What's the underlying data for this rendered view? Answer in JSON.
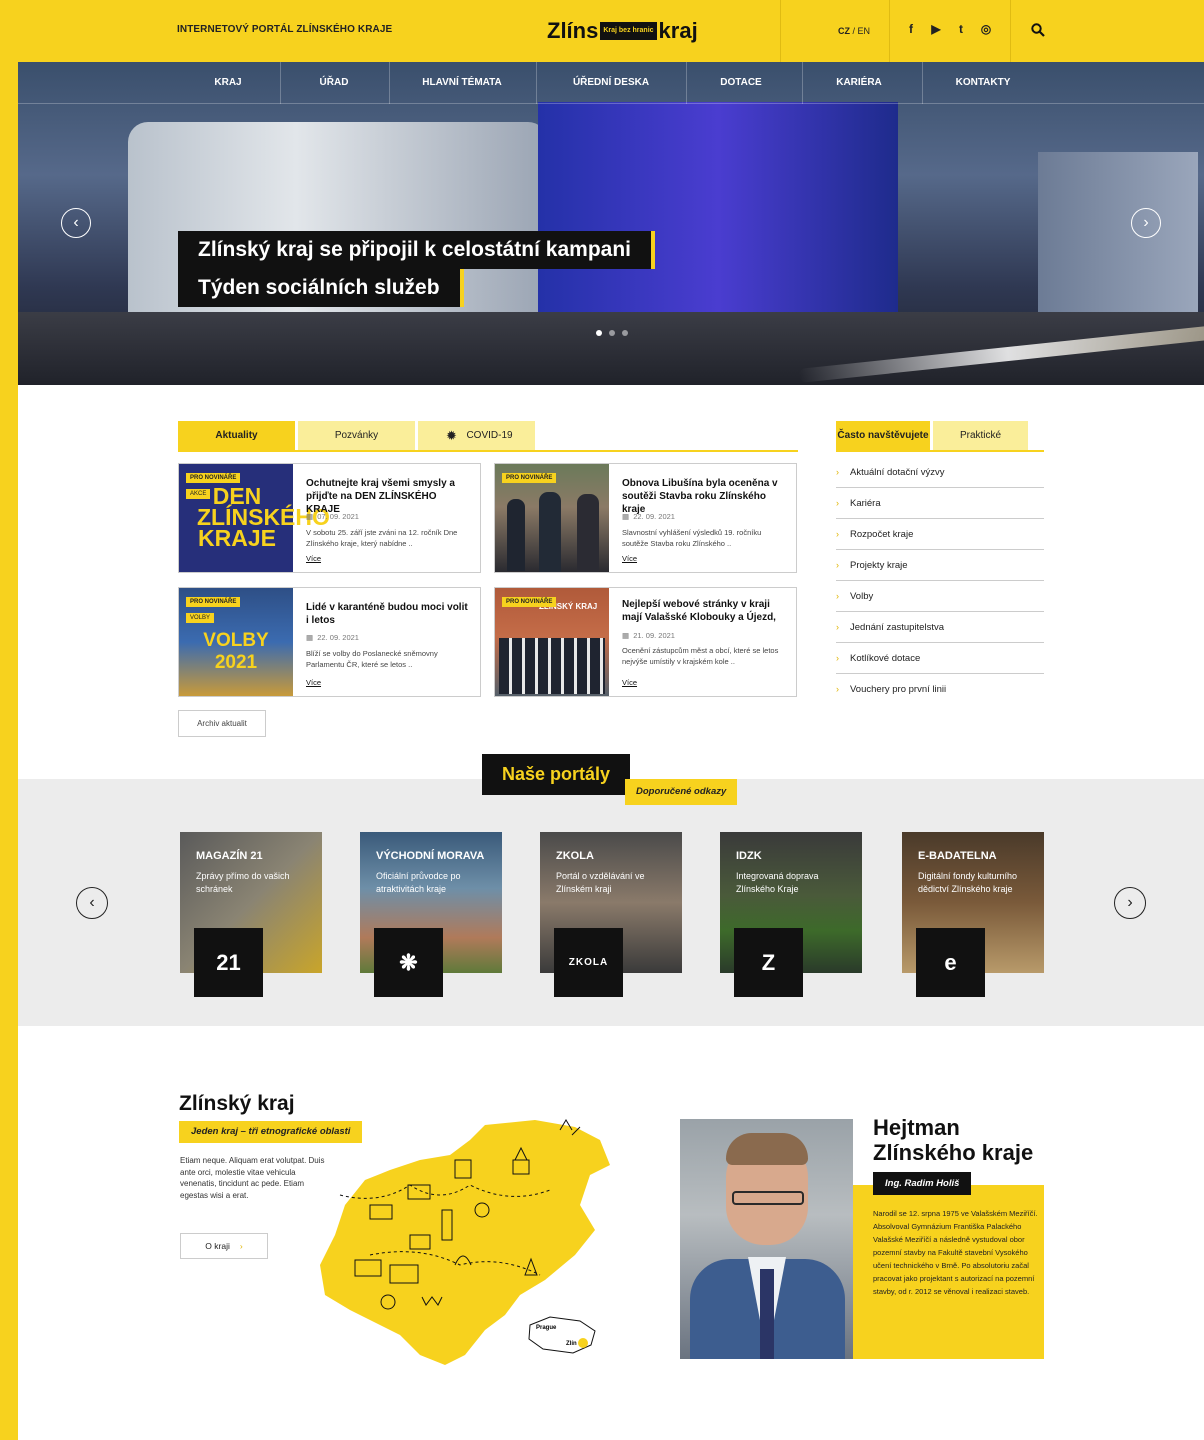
{
  "header": {
    "portal_label": "INTERNETOVÝ PORTÁL ZLÍNSKÉHO KRAJE",
    "logo_left": "Zlíns",
    "logo_box": "Kraj bez hranic",
    "logo_right": "kraj",
    "lang_cz": "CZ",
    "lang_sep": " / ",
    "lang_en": "EN",
    "socials": [
      "f",
      "▶",
      "t",
      "◎"
    ]
  },
  "nav": [
    "KRAJ",
    "ÚŘAD",
    "HLAVNÍ TÉMATA",
    "ÚŘEDNÍ DESKA",
    "DOTACE",
    "KARIÉRA",
    "KONTAKTY"
  ],
  "hero": {
    "title_line1": "Zlínský kraj se připojil k celostátní kampani",
    "title_line2": "Týden sociálních služeb",
    "prev": "‹",
    "next": "›"
  },
  "news": {
    "tabs": [
      "Aktuality",
      "Pozvánky",
      "COVID-19"
    ],
    "cards": [
      {
        "badge": "PRO NOVINÁŘE",
        "badge2": "AKCE",
        "img_text": "DEN ZLÍNSKÉHO KRAJE",
        "title": "Ochutnejte kraj všemi smysly a přijďte na DEN ZLÍNSKÉHO KRAJE",
        "date": "07. 09. 2021",
        "text": "V sobotu 25. září jste zváni na 12. ročník Dne Zlínského kraje, který nabídne ..",
        "more": "Více"
      },
      {
        "badge": "PRO NOVINÁŘE",
        "badge2": "",
        "img_text": "",
        "title": "Obnova Libušína byla oceněna v soutěži Stavba roku Zlínského kraje",
        "date": "22. 09. 2021",
        "text": "Slavnostní vyhlášení výsledků 19. ročníku soutěže Stavba roku Zlínského ..",
        "more": "Více"
      },
      {
        "badge": "PRO NOVINÁŘE",
        "badge2": "VOLBY",
        "img_text": "VOLBY 2021",
        "title": "Lidé v karanténě budou moci volit i letos",
        "date": "22. 09. 2021",
        "text": "Blíží se volby do Poslanecké sněmovny Parlamentu ČR, které se letos ..",
        "more": "Více"
      },
      {
        "badge": "PRO NOVINÁŘE",
        "badge2": "",
        "img_text": "ZLÍNSKÝ KRAJ",
        "title": "Nejlepší webové stránky v kraji mají Valašské Klobouky a Újezd,",
        "date": "21. 09. 2021",
        "text": "Ocenění zástupcům měst a obcí, které se letos nejvýše umístily v krajském kole ..",
        "more": "Více"
      }
    ],
    "archive": "Archiv aktualit"
  },
  "side": {
    "tabs": [
      "Často navštěvujete",
      "Praktické"
    ],
    "links": [
      "Aktuální dotační výzvy",
      "Kariéra",
      "Rozpočet kraje",
      "Projekty kraje",
      "Volby",
      "Jednání zastupitelstva",
      "Kotlíkové dotace",
      "Vouchery pro první linii"
    ]
  },
  "portals": {
    "title": "Naše portály",
    "subtitle": "Doporučené odkazy",
    "items": [
      {
        "name": "MAGAZÍN 21",
        "desc": "Zprávy přímo do vašich schránek",
        "icon": "21"
      },
      {
        "name": "VÝCHODNÍ MORAVA",
        "desc": "Oficiální průvodce po atraktivitách kraje",
        "icon": "❋"
      },
      {
        "name": "ZKOLA",
        "desc": "Portál o vzdělávání ve Zlínském kraji",
        "icon": "ZKOLA"
      },
      {
        "name": "IDZK",
        "desc": "Integrovaná doprava Zlínského Kraje",
        "icon": "Z"
      },
      {
        "name": "E-BADATELNA",
        "desc": "Digitální fondy kulturního dědictví Zlínského kraje",
        "icon": "e"
      }
    ]
  },
  "region": {
    "title": "Zlínský kraj",
    "subtitle": "Jeden kraj – tři etnografické oblasti",
    "text": "Etiam neque. Aliquam erat volutpat. Duis ante orci, molestie vitae vehicula venenatis, tincidunt ac pede. Etiam egestas wisi a erat.",
    "button": "O kraji",
    "map_prague": "Prague",
    "map_zlin": "Zlín"
  },
  "governor": {
    "title": "Hejtman Zlínského kraje",
    "name": "Ing. Radim Holiš",
    "bio": "Narodil se 12. srpna 1975 ve Valašském Meziříčí. Absolvoval Gymnázium Františka Palackého Valašské Meziříčí a následně vystudoval obor pozemní stavby na Fakultě stavební Vysokého učení technického v Brně. Po absolutoriu začal pracovat jako projektant s autorizací na pozemní stavby, od r. 2012 se věnoval i realizaci staveb."
  }
}
